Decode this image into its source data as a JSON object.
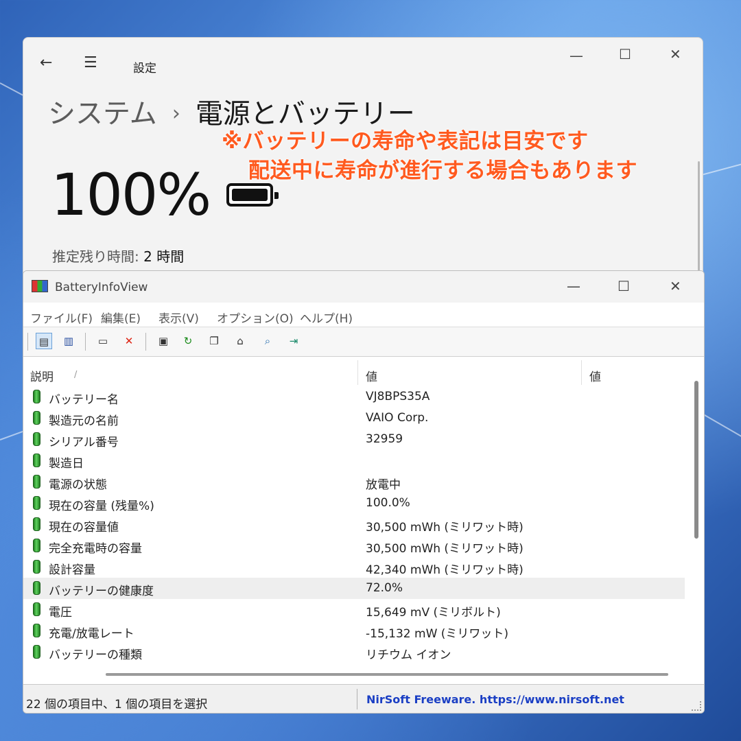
{
  "settings": {
    "app_title": "設定",
    "breadcrumb_parent": "システム",
    "breadcrumb_sep": "›",
    "page_title": "電源とバッテリー",
    "battery_percent": "100%",
    "battery_level": 1.0,
    "remaining_label": "推定残り時間:",
    "remaining_value": "2 時間",
    "controls": {
      "minimize": "—",
      "maximize": "☐",
      "close": "✕"
    },
    "icons": {
      "back": "back-arrow-icon",
      "menu": "hamburger-menu-icon",
      "battery": "battery-full-icon"
    }
  },
  "notice": {
    "line1": "※バッテリーの寿命や表記は目安です",
    "line2": "配送中に寿命が進行する場合もあります",
    "color": "#ff5a1f"
  },
  "biv": {
    "title": "BatteryInfoView",
    "controls": {
      "minimize": "—",
      "maximize": "☐",
      "close": "✕"
    },
    "menu": [
      "ファイル(F)",
      "編集(E)",
      "表示(V)",
      "オプション(O)",
      "ヘルプ(H)"
    ],
    "toolbar_icons": [
      "list-view-icon",
      "detail-view-icon",
      "properties-icon",
      "delete-icon",
      "save-icon",
      "refresh-icon",
      "copy-icon",
      "html-report-icon",
      "find-icon",
      "exit-icon"
    ],
    "columns": [
      "説明",
      "値",
      "値"
    ],
    "sort_indicator": "/",
    "rows": [
      {
        "label": "バッテリー名",
        "value": "VJ8BPS35A"
      },
      {
        "label": "製造元の名前",
        "value": "VAIO Corp."
      },
      {
        "label": "シリアル番号",
        "value": "32959"
      },
      {
        "label": "製造日",
        "value": ""
      },
      {
        "label": "電源の状態",
        "value": "放電中"
      },
      {
        "label": "現在の容量 (残量%)",
        "value": "100.0%"
      },
      {
        "label": "現在の容量値",
        "value": "30,500 mWh (ミリワット時)"
      },
      {
        "label": "完全充電時の容量",
        "value": "30,500 mWh (ミリワット時)"
      },
      {
        "label": "設計容量",
        "value": "42,340 mWh (ミリワット時)"
      },
      {
        "label": "バッテリーの健康度",
        "value": "72.0%",
        "selected": true
      },
      {
        "label": "電圧",
        "value": "15,649 mV (ミリボルト)"
      },
      {
        "label": "充電/放電レート",
        "value": "-15,132 mW (ミリワット)"
      },
      {
        "label": "バッテリーの種類",
        "value": "リチウム イオン"
      }
    ],
    "status_left": "22 個の項目中、1 個の項目を選択",
    "status_right": "NirSoft Freeware. https://www.nirsoft.net",
    "status_link_color": "#1b3fc4"
  }
}
